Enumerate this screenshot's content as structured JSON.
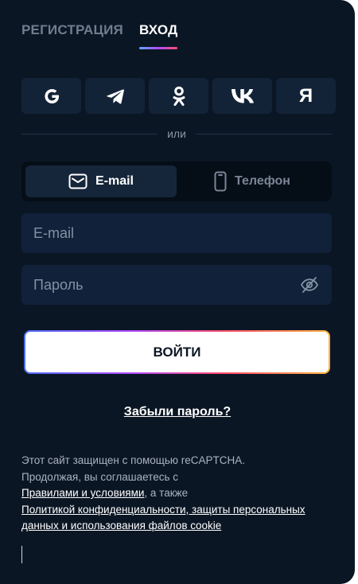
{
  "tabs": {
    "register": "РЕГИСТРАЦИЯ",
    "login": "ВХОД"
  },
  "socials": [
    {
      "name": "google",
      "icon": "google-icon"
    },
    {
      "name": "telegram",
      "icon": "telegram-icon"
    },
    {
      "name": "odnoklassniki",
      "icon": "odnoklassniki-icon"
    },
    {
      "name": "vk",
      "icon": "vk-icon"
    },
    {
      "name": "yandex",
      "icon": "yandex-icon",
      "glyph": "Я"
    }
  ],
  "divider": "или",
  "switch": {
    "email": "E-mail",
    "phone": "Телефон"
  },
  "fields": {
    "email_placeholder": "E-mail",
    "password_placeholder": "Пароль"
  },
  "submit": "ВОЙТИ",
  "forgot": "Забыли пароль?",
  "legal": {
    "line1": "Этот сайт защищен с помощью reCAPTCHA.",
    "line2": "Продолжая, вы соглашаетесь с",
    "rules_link": "Правилами и условиями",
    "also": ", а также",
    "privacy_link": "Политикой конфиденциальности, защиты персональных данных и использования файлов cookie"
  },
  "colors": {
    "background": "#0b1624",
    "accent_gradient": [
      "#5aa9ff",
      "#b14bff",
      "#ff4b6e",
      "#ffb340"
    ]
  }
}
